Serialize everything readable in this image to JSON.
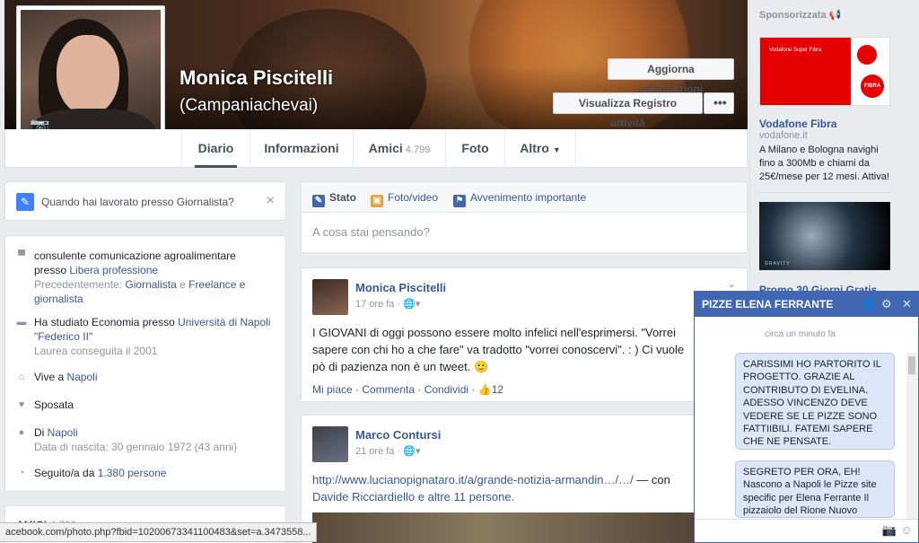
{
  "profile": {
    "name": "Monica Piscitelli",
    "alt_name": "(Campaniachevai)",
    "update_info_label": "Aggiorna informazioni",
    "activity_log_label": "Visualizza Registro attività",
    "more_label": "•••"
  },
  "tabs": {
    "diario": "Diario",
    "informazioni": "Informazioni",
    "amici": "Amici",
    "amici_count": "4.799",
    "foto": "Foto",
    "altro": "Altro"
  },
  "work_prompt": {
    "text": "Quando hai lavorato presso Giornalista?",
    "close": "×"
  },
  "intro": {
    "job_line1": "consulente comunicazione agroalimentare",
    "job_at": "presso ",
    "job_link": "Libera professione",
    "job_prev": "Precedentemente: ",
    "job_prev_link1": "Giornalista",
    "job_prev_and": " e ",
    "job_prev_link2": "Freelance e giornalista",
    "study_pre": "Ha studiato Economia presso ",
    "study_link": "Università di Napoli \"Federico II\"",
    "study_sub": "Laurea conseguita il 2001",
    "lives_pre": "Vive a ",
    "lives_link": "Napoli",
    "married": "Sposata",
    "from_pre": "Di ",
    "from_link": "Napoli",
    "birth": "Data di nascita: 30 gennaio 1972 (43 anni)",
    "followed_pre": "Seguito/a da ",
    "followed_link": "1.380 persone"
  },
  "friends_card": {
    "title": "AMICI",
    "count": "4.799"
  },
  "composer": {
    "tab_status": "Stato",
    "tab_photo": "Foto/video",
    "tab_event": "Avvenimento importante",
    "placeholder": "A cosa stai pensando?"
  },
  "post1": {
    "author": "Monica Piscitelli",
    "time": "17 ore fa · ",
    "text_line1": "I GIOVANI di oggi possono essere molto infelici nell'esprimersi. \"Vorrei",
    "text_line2": "sapere con chi ho a che fare\" va tradotto \"vorrei conoscervi\". : ) Ci vuole",
    "text_line3": "pò di pazienza non è un tweet. 🙂",
    "actions": "Mi piace · Commenta · Condividi · ",
    "likes": "12"
  },
  "post2": {
    "author": "Marco Contursi",
    "time": "21 ore fa · ",
    "link": "http://www.lucianopignataro.it/a/grande-notizia-armandin…/…/",
    "link_suffix": " — con",
    "tagged": "Davide Ricciardiello e altre 11 persone."
  },
  "sidebar": {
    "sponsored": "Sponsorizzata",
    "ad1_title": "Vodafone Fibra",
    "ad1_domain": "vodafone.it",
    "ad1_text": "A Milano e Bologna navighi fino a 300Mb e chiami da 25€/mese per 12 mesi. Attiva!",
    "ad1_img_text": "Vodafone Super Fibra",
    "ad1_badge": "FIBRA",
    "ad2_title": "Promo 30 Giorni Gratis",
    "ad2_img_text": "GRAVITY"
  },
  "chat": {
    "title": "PIZZE ELENA FERRANTE",
    "time": "circa un minuto fa",
    "msg1": "CARISSIMI HO PARTORITO IL PROGETTO. GRAZIE AL CONTRIBUTO DI EVELINA. ADESSO VINCENZO DEVE VEDERE SE LE PIZZE SONO FATTIIBILI. FATEMI SAPERE CHE NE PENSATE.",
    "msg2": "SEGRETO PER ORA, EH! Nascono a Napoli le Pizze site specific per Elena Ferrante Il pizzaiolo del Rione Nuovo"
  },
  "statusbar": {
    "url": "acebook.com/photo.php?fbid=10200673341100483&set=a.3473558..."
  },
  "colors": {
    "brand": "#4267b2",
    "link": "#365899",
    "background": "#e9ebee"
  }
}
